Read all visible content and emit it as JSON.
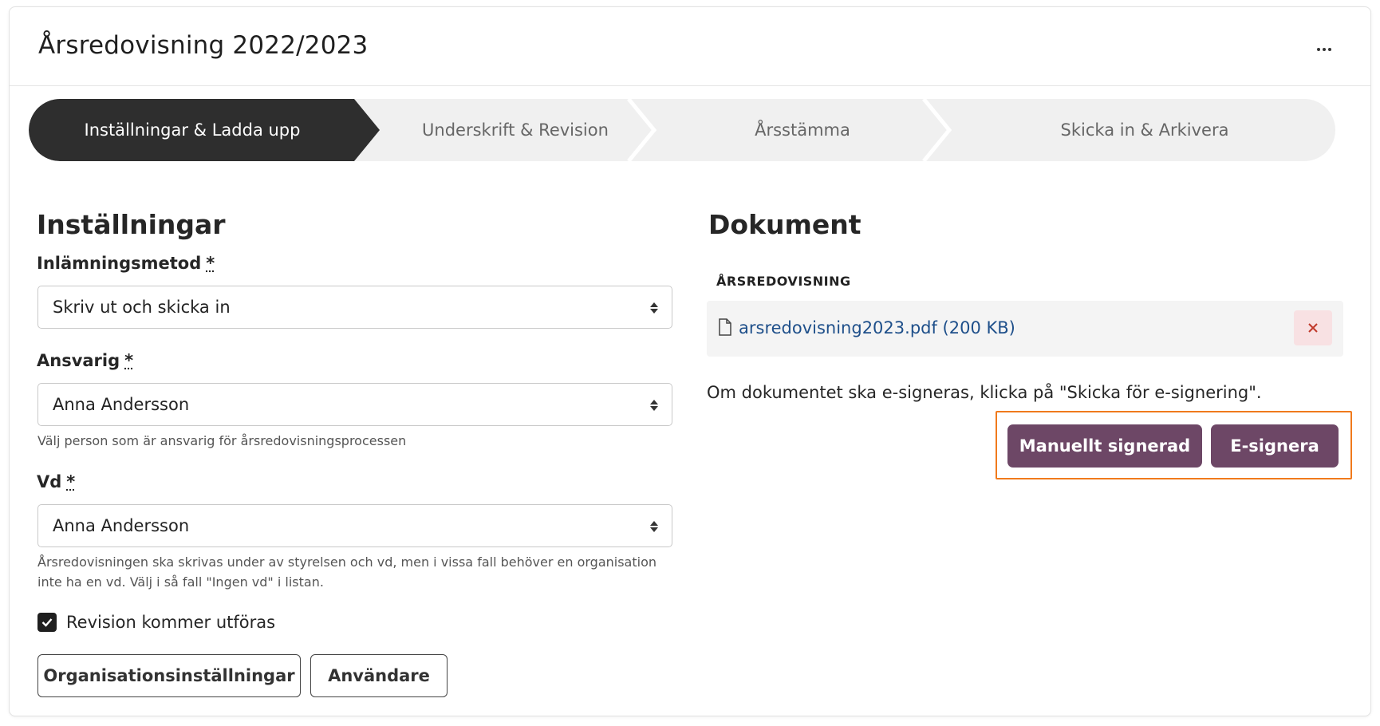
{
  "header": {
    "title": "Årsredovisning 2022/2023",
    "more_icon": "ellipsis-icon"
  },
  "stepper": {
    "steps": [
      {
        "label": "Inställningar & Ladda upp",
        "active": true
      },
      {
        "label": "Underskrift & Revision",
        "active": false
      },
      {
        "label": "Årsstämma",
        "active": false
      },
      {
        "label": "Skicka in & Arkivera",
        "active": false
      }
    ]
  },
  "settings": {
    "title": "Inställningar",
    "submission_method": {
      "label": "Inlämningsmetod",
      "required_mark": "*",
      "value": "Skriv ut och skicka in"
    },
    "responsible": {
      "label": "Ansvarig",
      "required_mark": "*",
      "value": "Anna Andersson",
      "help": "Välj person som är ansvarig för årsredovisningsprocessen"
    },
    "ceo": {
      "label": "Vd",
      "required_mark": "*",
      "value": "Anna Andersson",
      "help": "Årsredovisningen ska skrivas under av styrelsen och vd, men i vissa fall behöver en organisation inte ha en vd. Välj i så fall \"Ingen vd\" i listan."
    },
    "audit_checkbox": {
      "label": "Revision kommer utföras",
      "checked": true
    },
    "buttons": {
      "org_settings": "Organisationsinställningar",
      "users": "Användare"
    }
  },
  "documents": {
    "title": "Dokument",
    "section_heading": "ÅRSREDOVISNING",
    "file": {
      "name": "arsredovisning2023.pdf (200 KB)",
      "icon": "file-icon",
      "remove_icon": "close-icon"
    },
    "info_text": "Om dokumentet ska e-signeras, klicka på \"Skicka för e-signering\".",
    "buttons": {
      "manual": "Manuellt signerad",
      "esign": "E-signera"
    }
  },
  "colors": {
    "primary": "#6d4766",
    "active_step": "#2e2e2e",
    "link": "#1e4f8a",
    "highlight": "#f07a1c",
    "danger_bg": "#f8e1e3"
  }
}
